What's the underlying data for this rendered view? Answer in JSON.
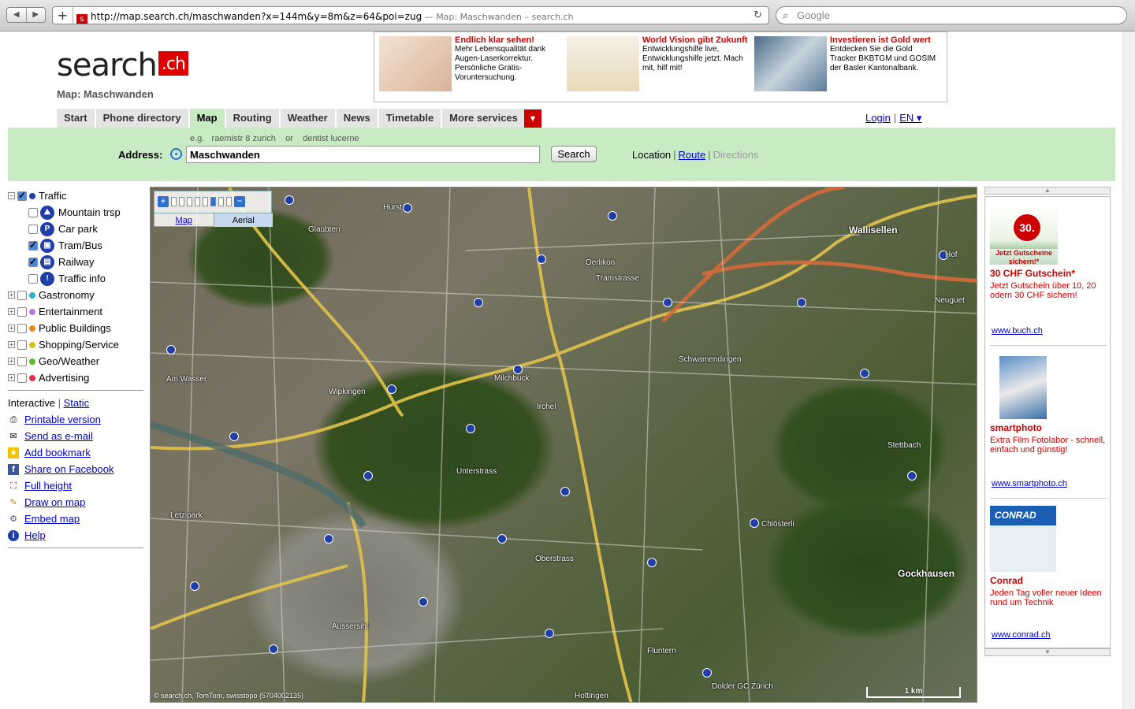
{
  "browser": {
    "back_label": "◀",
    "forward_label": "▶",
    "add_label": "+",
    "url": "http://map.search.ch/maschwanden?x=144m&y=8m&z=64&poi=zug",
    "page_title": " — Map: Maschwanden – search.ch",
    "search_placeholder": "Google"
  },
  "site": {
    "logo_text": "search",
    "logo_suffix": ".ch",
    "subtitle": "Map: Maschwanden"
  },
  "ads": [
    {
      "title": "Endlich klar sehen!",
      "text": "Mehr Lebensqualität dank Augen-Laserkorrektur. Persönliche Gratis-Voruntersuchung."
    },
    {
      "title": "World Vision gibt Zukunft",
      "text": "Entwicklungshilfe live, Entwicklungshilfe jetzt. Mach mit, hilf mit!"
    },
    {
      "title": "Investieren ist Gold wert",
      "text": "Entdecken Sie die Gold Tracker BKBTGM und GOSIM der Basler Kantonalbank."
    }
  ],
  "tabs": [
    "Start",
    "Phone directory",
    "Map",
    "Routing",
    "Weather",
    "News",
    "Timetable",
    "More services"
  ],
  "login": {
    "login_label": "Login",
    "lang_label": "EN ▾"
  },
  "search": {
    "hint_prefix": "e.g.",
    "hint_example1": "raemistr 8 zurich",
    "hint_or": "or",
    "hint_example2": "dentist lucerne",
    "address_label": "Address:",
    "address_value": "Maschwanden",
    "search_button": "Search",
    "mode_location": "Location",
    "mode_route": "Route",
    "mode_directions": "Directions"
  },
  "poi": {
    "traffic": "Traffic",
    "mountain": "Mountain trsp",
    "carpark": "Car park",
    "trambus": "Tram/Bus",
    "railway": "Railway",
    "trafficinfo": "Traffic info",
    "gastronomy": "Gastronomy",
    "entertainment": "Entertainment",
    "public": "Public Buildings",
    "shopping": "Shopping/Service",
    "geo": "Geo/Weather",
    "advertising": "Advertising"
  },
  "links": {
    "interactive": "Interactive",
    "static": "Static",
    "printable": "Printable version",
    "email": "Send as e-mail",
    "bookmark": "Add bookmark",
    "facebook": "Share on Facebook",
    "fullheight": "Full height",
    "draw": "Draw on map",
    "embed": "Embed map",
    "help": "Help"
  },
  "map": {
    "tab_map": "Map",
    "tab_aerial": "Aerial",
    "copyright": "© search.ch, TomTom, swisstopo (5704002135)",
    "scale": "1 km",
    "labels": {
      "hurst": "Hurst",
      "glaubten": "Glaubten",
      "oerlikon": "Oerlikon",
      "tramstrasse": "Tramstrasse",
      "wallisellen": "Wallisellen",
      "schwamendingen": "Schwamendingen",
      "milchbuck": "Milchbuck",
      "wipkingen": "Wipkingen",
      "irchel": "Irchel",
      "unterstrass": "Unterstrass",
      "stettbach": "Stettbach",
      "letzipark": "Letzipark",
      "oberstrass": "Oberstrass",
      "chloesterli": "Chlösterli",
      "gockhausen": "Gockhausen",
      "aussersihl": "Aussersihl",
      "hottingen": "Hottingen",
      "dolder": "Dolder GC Zürich",
      "fluntern": "Fluntern",
      "amwasser": "Am Wasser",
      "neuguet": "Neuguet",
      "hof": "Hof"
    }
  },
  "sidebar_ads": [
    {
      "img_text": "30.",
      "caption": "Jetzt Gutscheine sichern!*",
      "title": "30 CHF Gutschein*",
      "text": "Jetzt Gutschein über 10, 20 odern 30 CHF sichern!",
      "link": "www.buch.ch"
    },
    {
      "title": "smartphoto",
      "text": "Extra Film Fotolabor - schnell, einfach und günstig!",
      "link": "www.smartphoto.ch"
    },
    {
      "img_text": "CONRAD",
      "title": "Conrad",
      "text": "Jeden Tag voller neuer Ideen rund um Technik",
      "link": "www.conrad.ch"
    }
  ],
  "colors": {
    "brand_red": "#dd0000",
    "panel_green": "#c9ebc3",
    "link_blue": "#0000cc"
  }
}
